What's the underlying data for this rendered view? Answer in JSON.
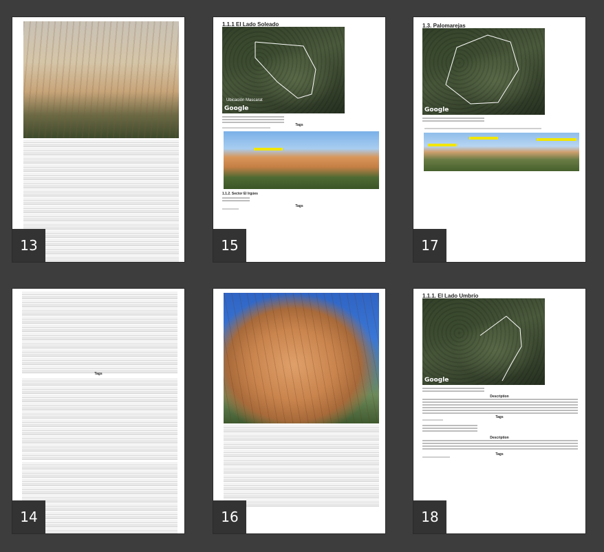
{
  "pages": [
    {
      "number": "13"
    },
    {
      "number": "15",
      "title": "1.1.1 El Lado Soleado",
      "map_label": "Google",
      "map_overlay": "Ubicación Mascarat",
      "section": "Tags",
      "sub_title": "1.1.2. Sector El Irgúes"
    },
    {
      "number": "17",
      "title": "1.3. Palomarejas",
      "map_label": "Google"
    },
    {
      "number": "14",
      "section": "Tags"
    },
    {
      "number": "16"
    },
    {
      "number": "18",
      "title": "1.1.1. El Lado Umbrío",
      "map_label": "Google",
      "section_desc": "Description",
      "section_tags": "Tags"
    }
  ]
}
